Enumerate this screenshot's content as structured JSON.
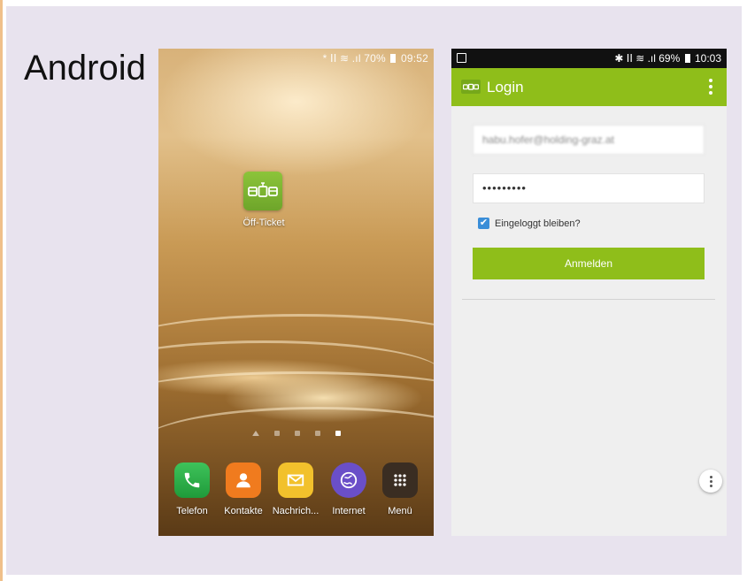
{
  "platform_label": "Android",
  "home_screen": {
    "status_bar": {
      "icons": "* ⅠⅠ ≋ .ıl",
      "battery": "70%",
      "time": "09:52"
    },
    "app_icon_label": "Öff-Ticket",
    "page_dots": 5,
    "dock": [
      {
        "label": "Telefon",
        "icon": "phone-icon",
        "color": "#2fb34a"
      },
      {
        "label": "Kontakte",
        "icon": "contact-icon",
        "color": "#f07b1e"
      },
      {
        "label": "Nachrich...",
        "icon": "message-icon",
        "color": "#f2c12c"
      },
      {
        "label": "Internet",
        "icon": "globe-icon",
        "color": "#6a4fc8"
      },
      {
        "label": "Menü",
        "icon": "apps-grid-icon",
        "color": "#3a2d22"
      }
    ]
  },
  "login_screen": {
    "status_bar": {
      "battery": "69%",
      "time": "10:03"
    },
    "title": "Login",
    "email_value": "habu.hofer@holding-graz.at",
    "password_value": "•••••••••",
    "remember_label": "Eingeloggt bleiben?",
    "remember_checked": true,
    "submit_label": "Anmelden",
    "accent_color": "#8fbe1a"
  }
}
